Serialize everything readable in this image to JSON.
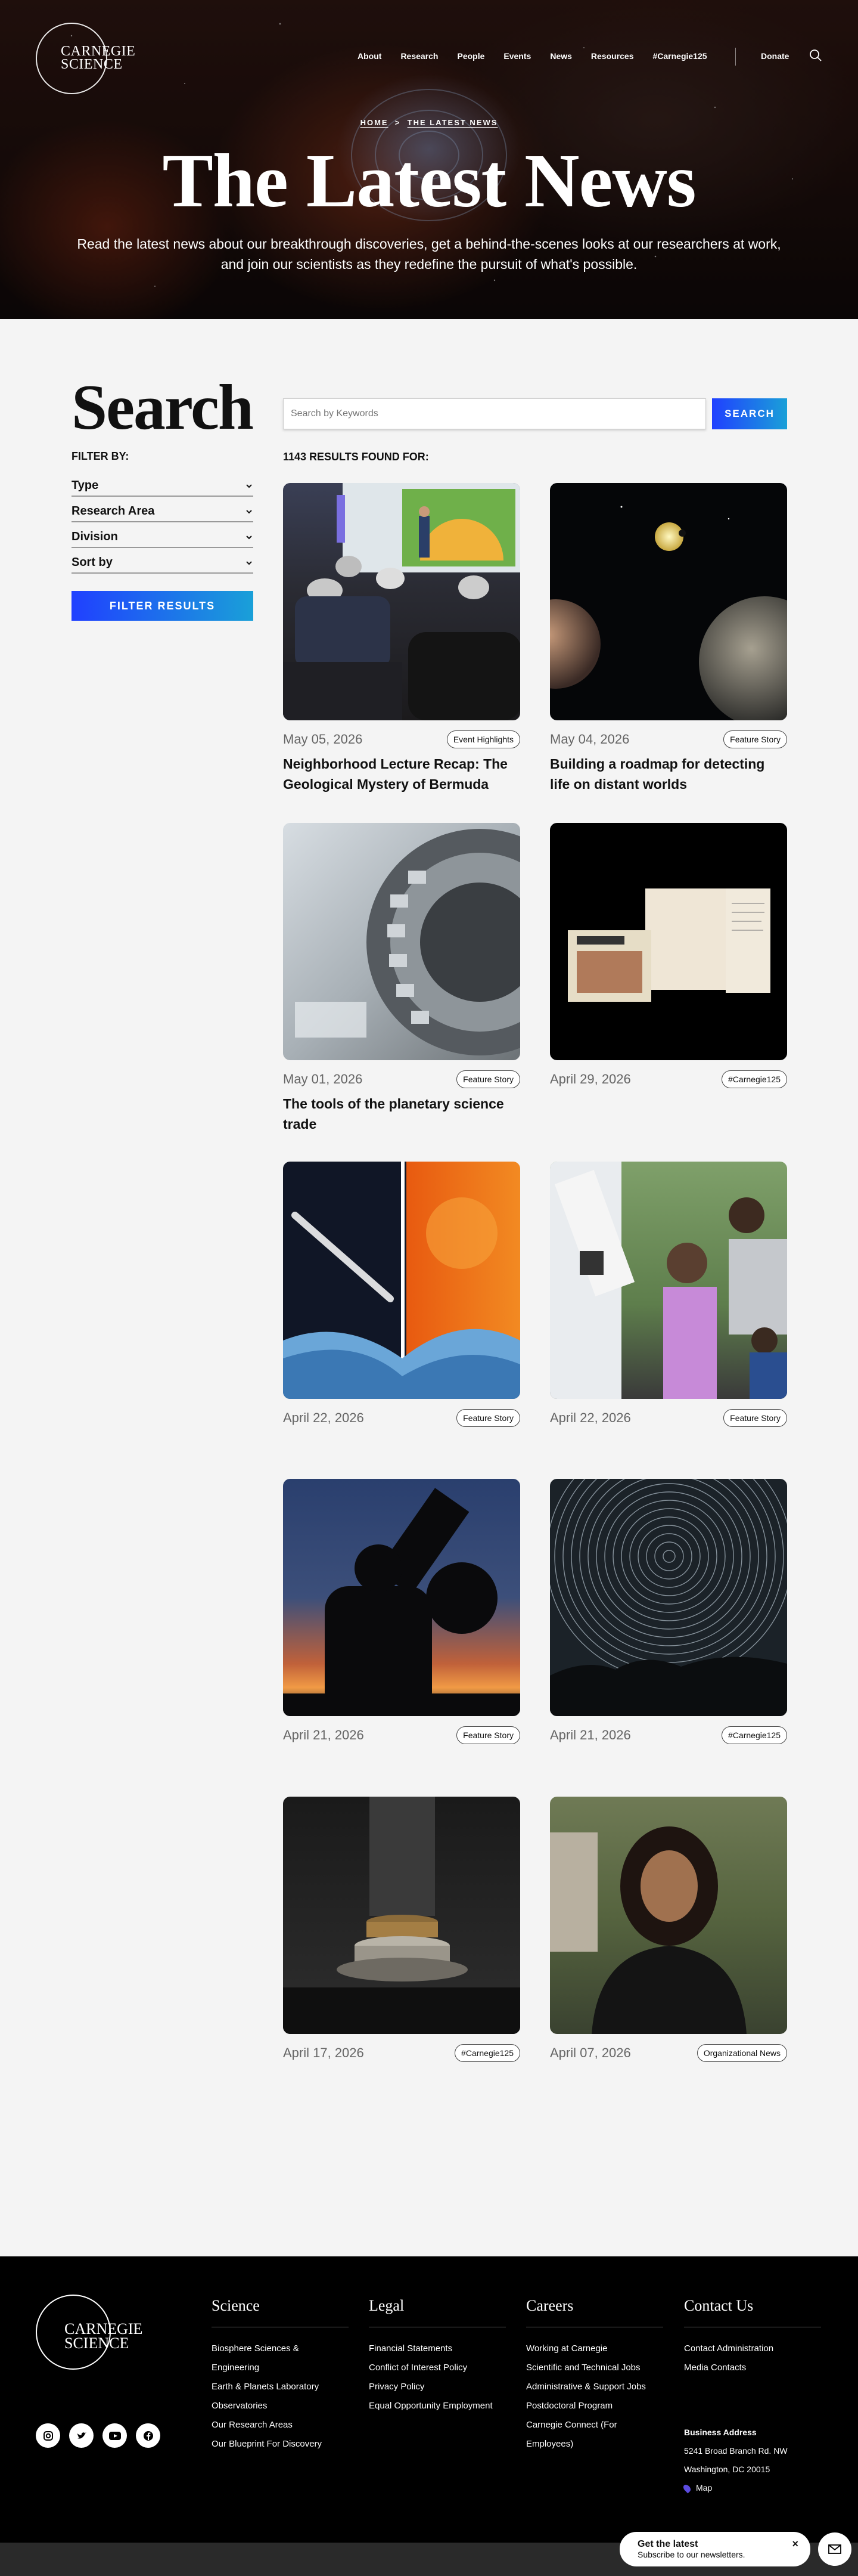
{
  "header": {
    "logo_line1": "CARNEGIE",
    "logo_line2": "SCIENCE",
    "nav": [
      "About",
      "Research",
      "People",
      "Events",
      "News",
      "Resources",
      "#Carnegie125"
    ],
    "donate": "Donate",
    "search_icon": "search-icon"
  },
  "hero": {
    "breadcrumb_home": "HOME",
    "breadcrumb_sep": ">",
    "breadcrumb_current": "THE LATEST NEWS",
    "title": "The Latest News",
    "subtitle_line1": "Read the latest news about our breakthrough discoveries, get a behind-the-scenes looks at our researchers at work,",
    "subtitle_line2": "and join our scientists as they redefine the pursuit of what's possible."
  },
  "search": {
    "heading": "Search",
    "placeholder": "Search by Keywords",
    "button": "SEARCH",
    "filter_by": "FILTER BY:",
    "filters": [
      "Type",
      "Research Area",
      "Division",
      "Sort by"
    ],
    "filter_button": "FILTER RESULTS",
    "results": "1143 RESULTS FOUND FOR:"
  },
  "cards": [
    {
      "date": "May 05, 2026",
      "tag": "Event Highlights",
      "title": "Neighborhood Lecture Recap: The Geological Mystery of Bermuda",
      "image": "lecture-photo"
    },
    {
      "date": "May 04, 2026",
      "tag": "Feature Story",
      "title": "Building a roadmap for detecting life on distant worlds",
      "image": "exoplanets-illustration"
    },
    {
      "date": "May 01, 2026",
      "tag": "Feature Story",
      "title": "The tools of the planetary science trade",
      "image": "metal-instrument-photo"
    },
    {
      "date": "April 29, 2026",
      "tag": "#Carnegie125",
      "title": "",
      "image": "archive-documents-photo"
    },
    {
      "date": "April 22, 2026",
      "tag": "Feature Story",
      "title": "",
      "image": "comet-water-sun-collage"
    },
    {
      "date": "April 22, 2026",
      "tag": "Feature Story",
      "title": "",
      "image": "telescope-outreach-photo"
    },
    {
      "date": "April 21, 2026",
      "tag": "Feature Story",
      "title": "",
      "image": "telescope-silhouette-photo"
    },
    {
      "date": "April 21, 2026",
      "tag": "#Carnegie125",
      "title": "",
      "image": "star-trails-photo"
    },
    {
      "date": "April 17, 2026",
      "tag": "#Carnegie125",
      "title": "",
      "image": "high-pressure-press-photo"
    },
    {
      "date": "April 07, 2026",
      "tag": "Organizational News",
      "title": "",
      "image": "portrait-photo"
    }
  ],
  "footer": {
    "logo_line1": "CARNEGIE",
    "logo_line2": "SCIENCE",
    "columns": [
      {
        "heading": "Science",
        "links": [
          "Biosphere Sciences & Engineering",
          "Earth & Planets Laboratory",
          "Observatories",
          "Our Research Areas",
          "Our Blueprint For Discovery"
        ]
      },
      {
        "heading": "Legal",
        "links": [
          "Financial Statements",
          "Conflict of Interest Policy",
          "Privacy Policy",
          "Equal Opportunity Employment"
        ]
      },
      {
        "heading": "Careers",
        "links": [
          "Working at Carnegie",
          "Scientific and Technical Jobs",
          "Administrative & Support Jobs",
          "Postdoctoral Program",
          "Carnegie Connect (For Employees)"
        ]
      },
      {
        "heading": "Contact Us",
        "links": [
          "Contact Administration",
          "Media Contacts"
        ]
      }
    ],
    "address_label": "Business Address",
    "address_line1": "5241 Broad Branch Rd. NW",
    "address_line2": "Washington, DC 20015",
    "map": "Map",
    "socials": [
      "instagram-icon",
      "twitter-icon",
      "youtube-icon",
      "facebook-icon"
    ]
  },
  "newsletter": {
    "title": "Get the latest",
    "subtitle": "Subscribe to our newsletters.",
    "close": "×"
  },
  "colors": {
    "accent_start": "#2040ff",
    "accent_end": "#1aa0d8",
    "footer_bg": "#000000"
  }
}
